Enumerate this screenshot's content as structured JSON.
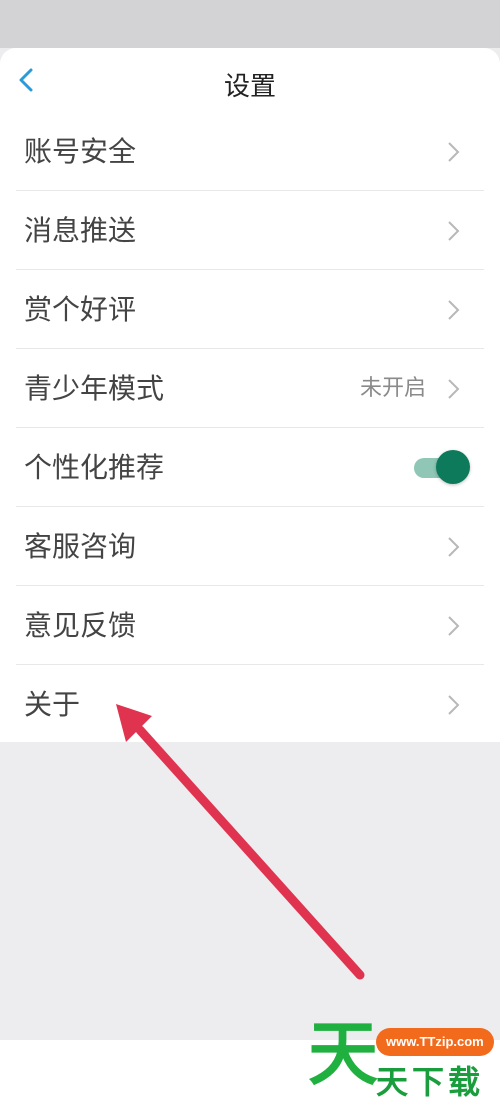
{
  "header": {
    "title": "设置"
  },
  "settings": {
    "items": [
      {
        "label": "账号安全"
      },
      {
        "label": "消息推送"
      },
      {
        "label": "赏个好评"
      },
      {
        "label": "青少年模式",
        "value": "未开启"
      },
      {
        "label": "个性化推荐",
        "toggle_on": true
      },
      {
        "label": "客服咨询"
      },
      {
        "label": "意见反馈"
      },
      {
        "label": "关于"
      }
    ]
  },
  "colors": {
    "accent": "#0d7a5c",
    "back_icon": "#2a9bd8",
    "annotation_arrow": "#e0334f"
  },
  "icons": {
    "back": "chevron-left-icon",
    "row": "chevron-right-icon"
  },
  "watermark": {
    "big_char": "天",
    "url": "www.TTzip.com",
    "text": "天下载"
  }
}
